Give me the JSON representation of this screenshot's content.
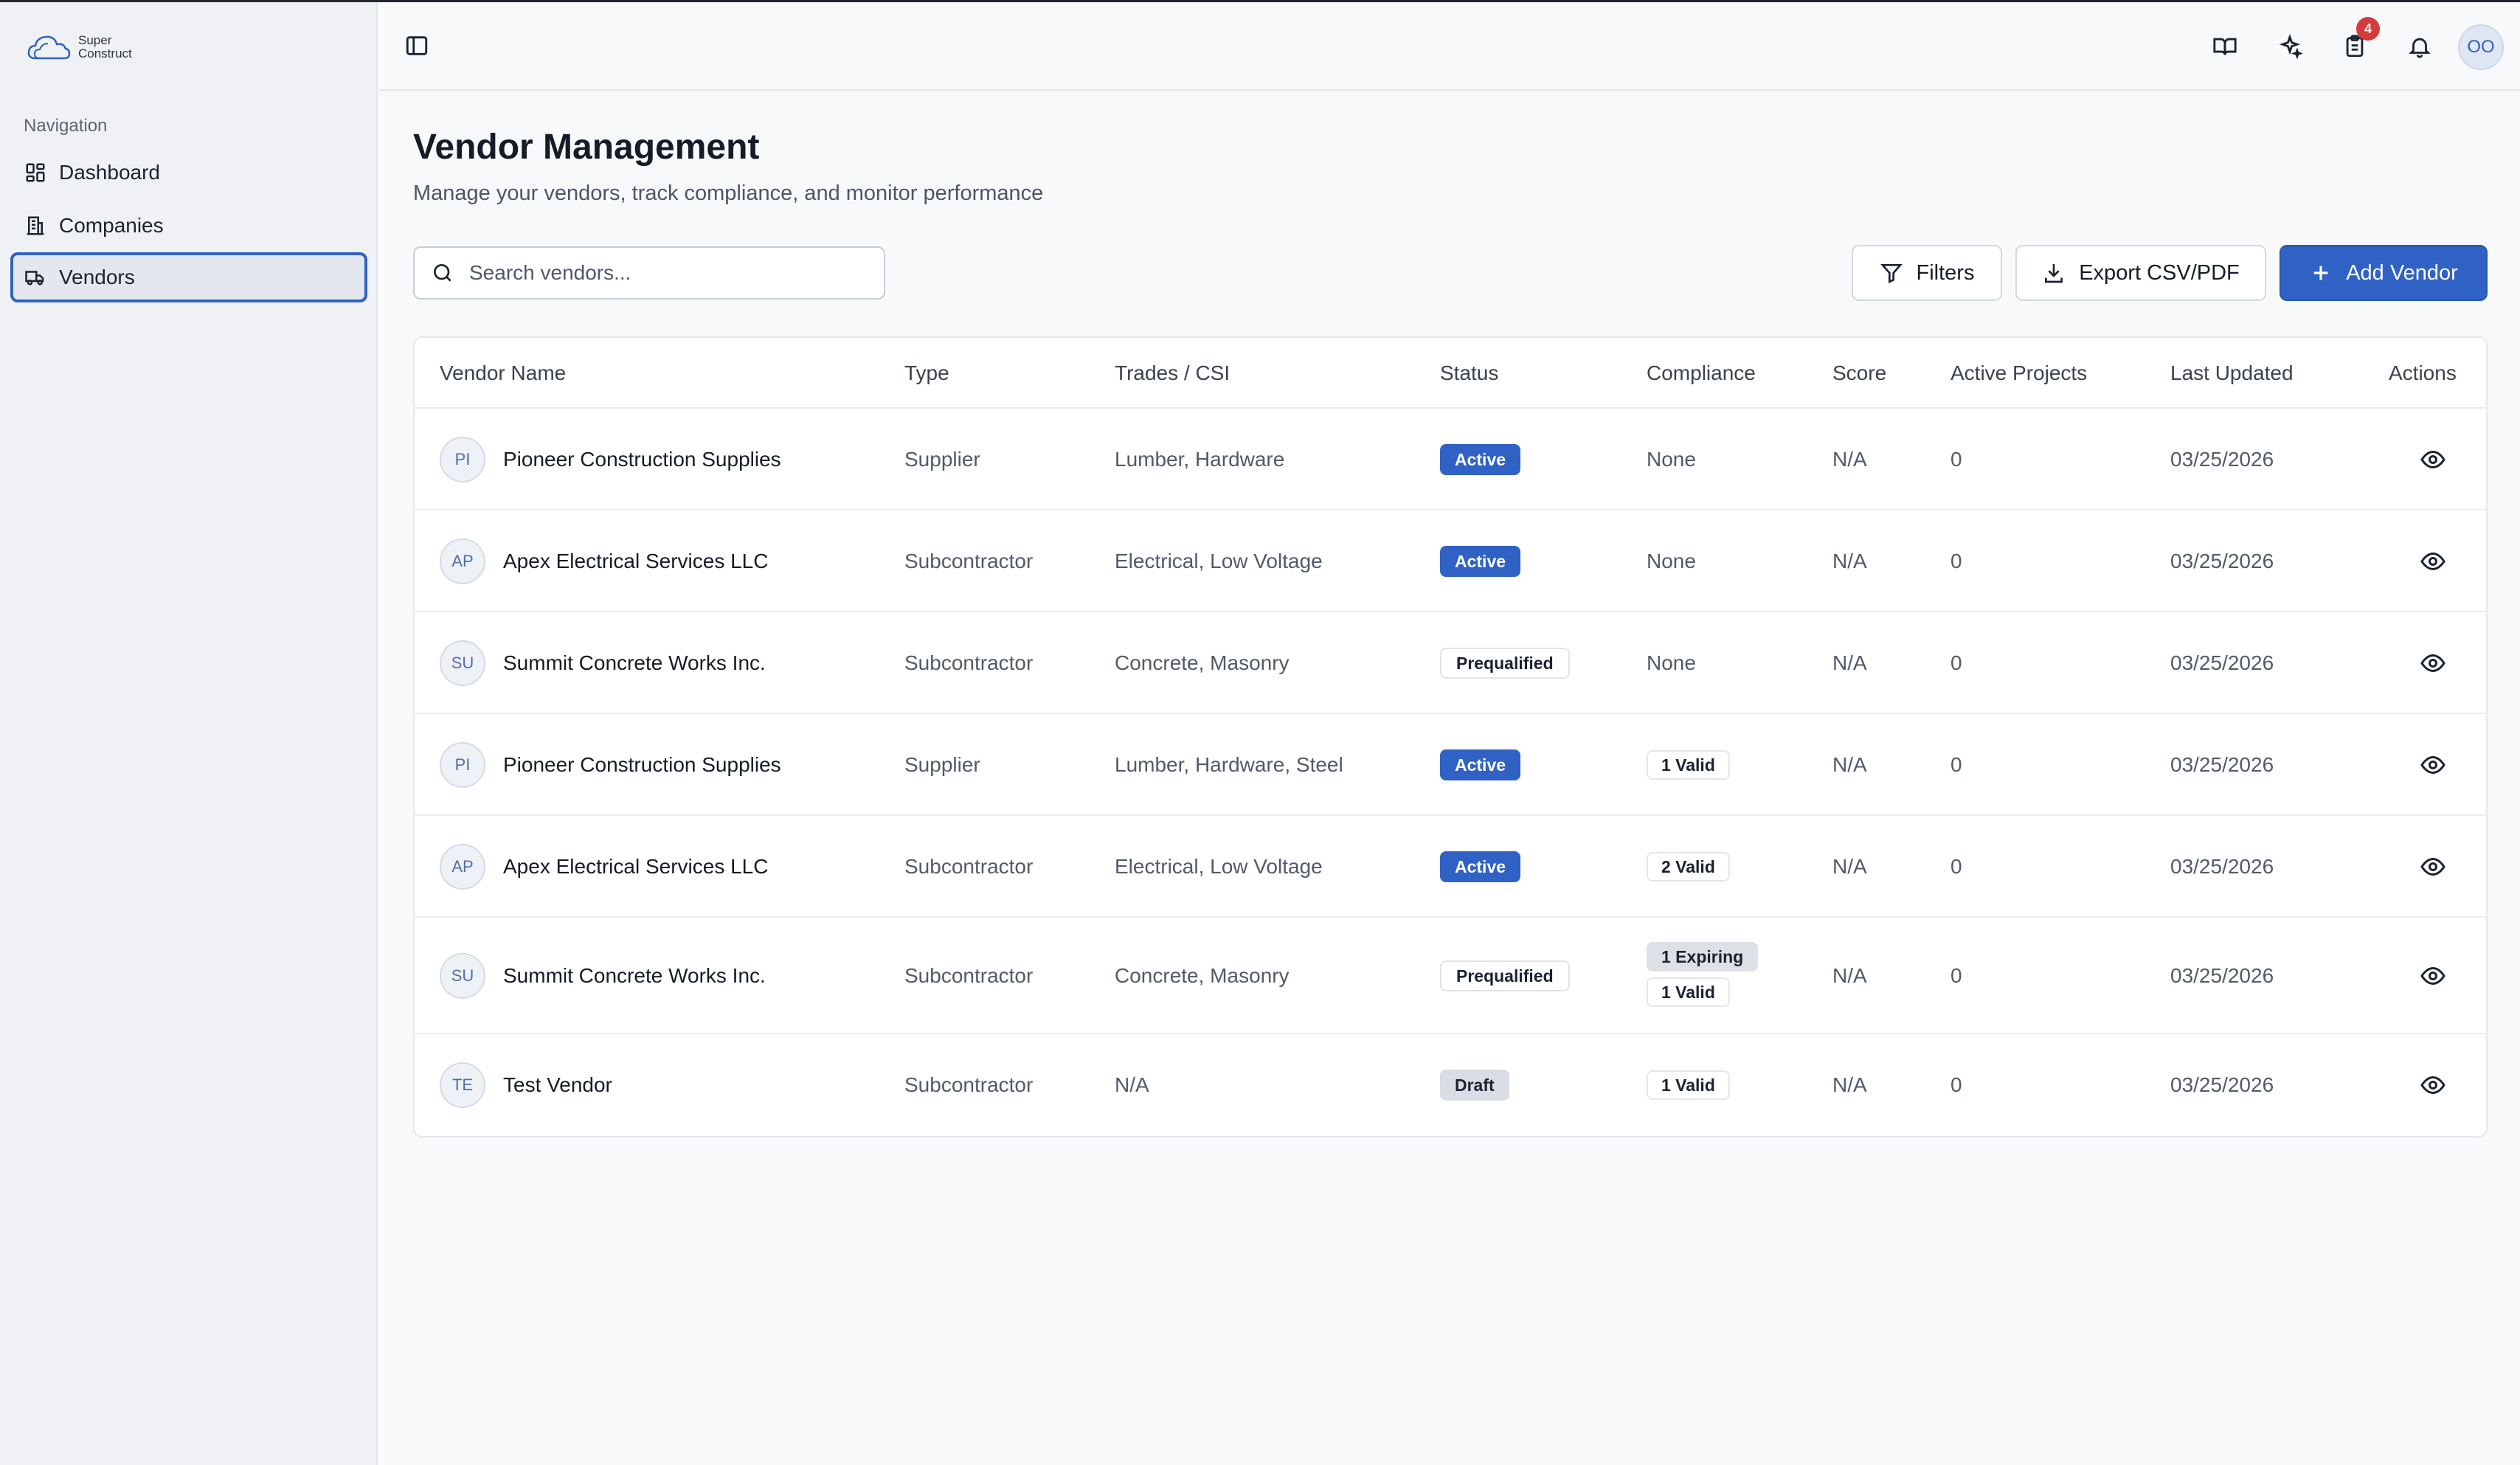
{
  "app": {
    "logo_line1": "Super",
    "logo_line2": "Construct",
    "colors": {
      "accent": "#2f62c4",
      "badge": "#d63b3b",
      "sidebar_bg": "#f0f1f4"
    }
  },
  "sidebar": {
    "heading": "Navigation",
    "items": [
      {
        "label": "Dashboard",
        "icon": "dashboard-grid-icon"
      },
      {
        "label": "Companies",
        "icon": "building-icon"
      },
      {
        "label": "Vendors",
        "icon": "truck-icon",
        "active": true
      }
    ]
  },
  "header": {
    "icons": [
      "sidebar-toggle-icon",
      "book-icon",
      "sparkles-icon",
      "clipboard-icon",
      "bell-icon"
    ],
    "clipboard_badge": "4",
    "user_initials": "OO"
  },
  "page": {
    "title": "Vendor Management",
    "subtitle": "Manage your vendors, track compliance, and monitor performance"
  },
  "toolbar": {
    "search_placeholder": "Search vendors...",
    "filters_label": "Filters",
    "export_label": "Export CSV/PDF",
    "add_label": "Add Vendor"
  },
  "table": {
    "columns": [
      "Vendor Name",
      "Type",
      "Trades / CSI",
      "Status",
      "Compliance",
      "Score",
      "Active Projects",
      "Last Updated",
      "Actions"
    ],
    "rows": [
      {
        "initials": "PI",
        "name": "Pioneer Construction Supplies",
        "type": "Supplier",
        "trades": "Lumber, Hardware",
        "status": "Active",
        "compliance_text": "None",
        "compliance_badges": [],
        "score": "N/A",
        "projects": "0",
        "updated": "03/25/2026"
      },
      {
        "initials": "AP",
        "name": "Apex Electrical Services LLC",
        "type": "Subcontractor",
        "trades": "Electrical, Low Voltage",
        "status": "Active",
        "compliance_text": "None",
        "compliance_badges": [],
        "score": "N/A",
        "projects": "0",
        "updated": "03/25/2026"
      },
      {
        "initials": "SU",
        "name": "Summit Concrete Works Inc.",
        "type": "Subcontractor",
        "trades": "Concrete, Masonry",
        "status": "Prequalified",
        "compliance_text": "None",
        "compliance_badges": [],
        "score": "N/A",
        "projects": "0",
        "updated": "03/25/2026"
      },
      {
        "initials": "PI",
        "name": "Pioneer Construction Supplies",
        "type": "Supplier",
        "trades": "Lumber, Hardware, Steel",
        "status": "Active",
        "compliance_text": "",
        "compliance_badges": [
          "1 Valid"
        ],
        "score": "N/A",
        "projects": "0",
        "updated": "03/25/2026"
      },
      {
        "initials": "AP",
        "name": "Apex Electrical Services LLC",
        "type": "Subcontractor",
        "trades": "Electrical, Low Voltage",
        "status": "Active",
        "compliance_text": "",
        "compliance_badges": [
          "2 Valid"
        ],
        "score": "N/A",
        "projects": "0",
        "updated": "03/25/2026"
      },
      {
        "initials": "SU",
        "name": "Summit Concrete Works Inc.",
        "type": "Subcontractor",
        "trades": "Concrete, Masonry",
        "status": "Prequalified",
        "compliance_text": "",
        "compliance_badges": [
          "1 Expiring",
          "1 Valid"
        ],
        "score": "N/A",
        "projects": "0",
        "updated": "03/25/2026"
      },
      {
        "initials": "TE",
        "name": "Test Vendor",
        "type": "Subcontractor",
        "trades": "N/A",
        "status": "Draft",
        "compliance_text": "",
        "compliance_badges": [
          "1 Valid"
        ],
        "score": "N/A",
        "projects": "0",
        "updated": "03/25/2026"
      }
    ]
  }
}
